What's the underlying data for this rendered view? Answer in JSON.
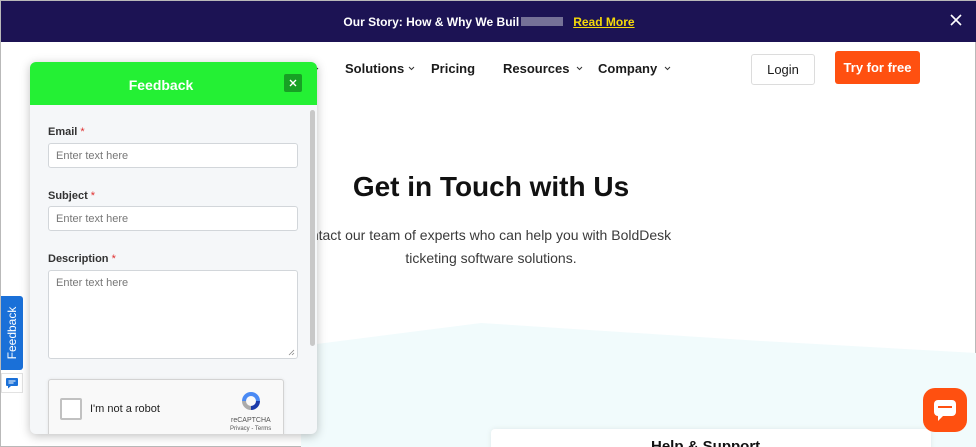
{
  "announcement": {
    "text": "Our Story: How & Why We Buil",
    "link": "Read More"
  },
  "nav": {
    "items": [
      {
        "label": "Solutions"
      },
      {
        "label": "Pricing"
      },
      {
        "label": "Resources"
      },
      {
        "label": "Company"
      }
    ],
    "login": "Login",
    "try_free": "Try for free"
  },
  "hero": {
    "title": "Get in Touch with Us",
    "subtitle_line1": "ntact our team of experts who can help you with BoldDesk",
    "subtitle_line2": "ticketing software solutions."
  },
  "help_card": {
    "title": "Help & Support"
  },
  "side_tab": {
    "label": "Feedback"
  },
  "feedback": {
    "title": "Feedback",
    "email_label": "Email",
    "subject_label": "Subject",
    "description_label": "Description",
    "required_mark": "*",
    "placeholder": "Enter text here"
  },
  "captcha": {
    "label": "I'm not a robot",
    "brand": "reCAPTCHA",
    "links": "Privacy - Terms"
  },
  "colors": {
    "announcement_bg": "#1c1354",
    "accent_orange": "#ff5010",
    "feedback_header": "#24f034",
    "feedback_tab": "#1a70d8"
  }
}
